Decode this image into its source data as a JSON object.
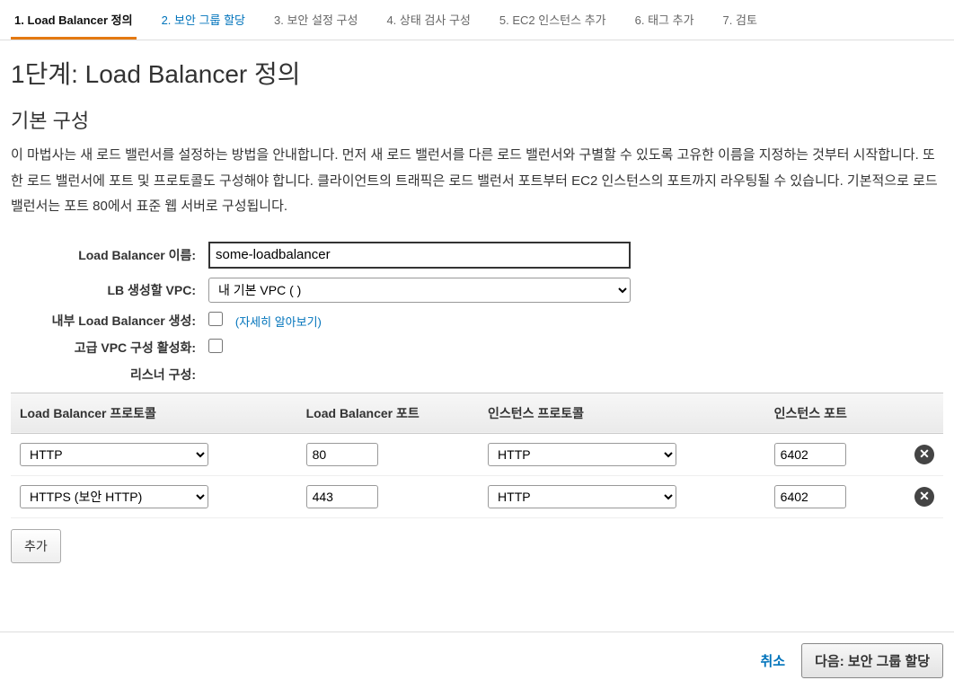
{
  "wizard": {
    "steps": [
      "1. Load Balancer 정의",
      "2. 보안 그룹 할당",
      "3. 보안 설정 구성",
      "4. 상태 검사 구성",
      "5. EC2 인스턴스 추가",
      "6. 태그 추가",
      "7. 검토"
    ],
    "activeIndex": 0
  },
  "page": {
    "title": "1단계: Load Balancer 정의",
    "subtitle": "기본 구성",
    "description": "이 마법사는 새 로드 밸런서를 설정하는 방법을 안내합니다. 먼저 새 로드 밸런서를 다른 로드 밸런서와 구별할 수 있도록 고유한 이름을 지정하는 것부터 시작합니다. 또한 로드 밸런서에 포트 및 프로토콜도 구성해야 합니다. 클라이언트의 트래픽은 로드 밸런서 포트부터 EC2 인스턴스의 포트까지 라우팅될 수 있습니다. 기본적으로 로드 밸런서는 포트 80에서 표준 웹 서버로 구성됩니다."
  },
  "form": {
    "labels": {
      "name": "Load Balancer 이름:",
      "vpc": "LB 생성할 VPC:",
      "internal": "내부 Load Balancer 생성:",
      "advancedVpc": "고급 VPC 구성 활성화:",
      "listeners": "리스너 구성:"
    },
    "nameValue": "some-loadbalancer",
    "vpcValue": "내 기본 VPC (                              )",
    "learnMore": "(자세히 알아보기)"
  },
  "listeners": {
    "headers": {
      "lbProtocol": "Load Balancer 프로토콜",
      "lbPort": "Load Balancer 포트",
      "instProtocol": "인스턴스 프로토콜",
      "instPort": "인스턴스 포트"
    },
    "rows": [
      {
        "lbProtocol": "HTTP",
        "lbPort": "80",
        "instProtocol": "HTTP",
        "instPort": "6402"
      },
      {
        "lbProtocol": "HTTPS (보안 HTTP)",
        "lbPort": "443",
        "instProtocol": "HTTP",
        "instPort": "6402"
      }
    ],
    "addLabel": "추가"
  },
  "footer": {
    "cancel": "취소",
    "next": "다음: 보안 그룹 할당"
  }
}
